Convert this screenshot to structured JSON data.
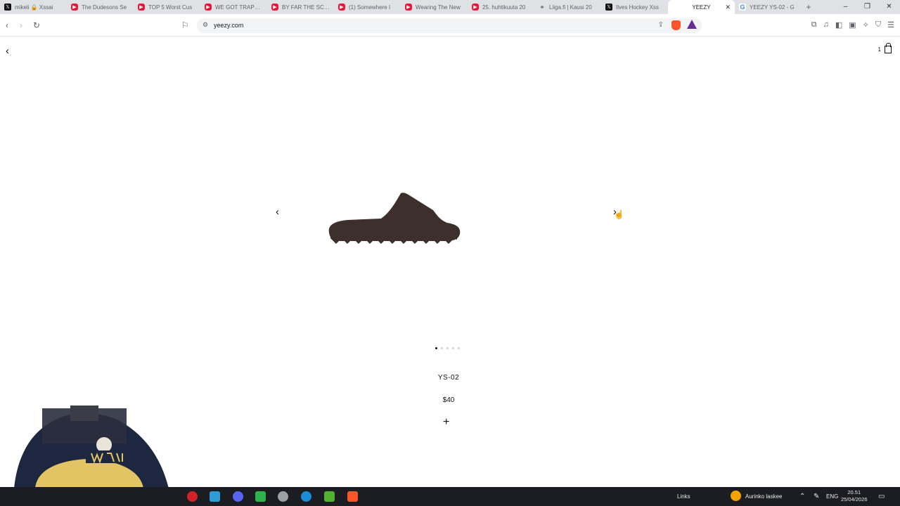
{
  "tabs": [
    {
      "icon": "x-icon",
      "title": "mikeli 🔒 Xssai"
    },
    {
      "icon": "youtube-icon",
      "title": "The Dudesons Se"
    },
    {
      "icon": "youtube-icon",
      "title": "TOP 5 Worst Cus"
    },
    {
      "icon": "youtube-icon",
      "title": "WE GOT TRAPPED"
    },
    {
      "icon": "youtube-icon",
      "title": "BY FAR THE SCAR"
    },
    {
      "icon": "youtube-icon",
      "title": "(1) Somewhere I"
    },
    {
      "icon": "youtube-icon",
      "title": "Wearing The New"
    },
    {
      "icon": "youtube-icon",
      "title": "25. huhtikuuta 20"
    },
    {
      "icon": "link-icon",
      "title": "Liiga.fi | Kausi 20"
    },
    {
      "icon": "x-icon",
      "title": "Ilves Hockey Xss"
    },
    {
      "icon": "none",
      "title": "YEEZY",
      "active": true
    },
    {
      "icon": "google-icon",
      "title": "YEEZY YS-02 - G"
    }
  ],
  "window_controls": {
    "minimize": "–",
    "restore": "❐",
    "close": "✕"
  },
  "address_bar": {
    "url": "yeezy.com"
  },
  "page": {
    "cart_count": "1",
    "product": {
      "name": "YS-02",
      "price": "$40"
    },
    "carousel": {
      "total_slides": 5,
      "active_slide": 1
    },
    "add_symbol": "+"
  },
  "taskbar": {
    "links_label": "Links",
    "weather": "Aurinko laskee",
    "language": "ENG",
    "time": "20.51",
    "date": "25/04/2026"
  },
  "colors": {
    "product": "#3d302c",
    "youtube": "#e8173a",
    "brave": "#fb542b"
  }
}
